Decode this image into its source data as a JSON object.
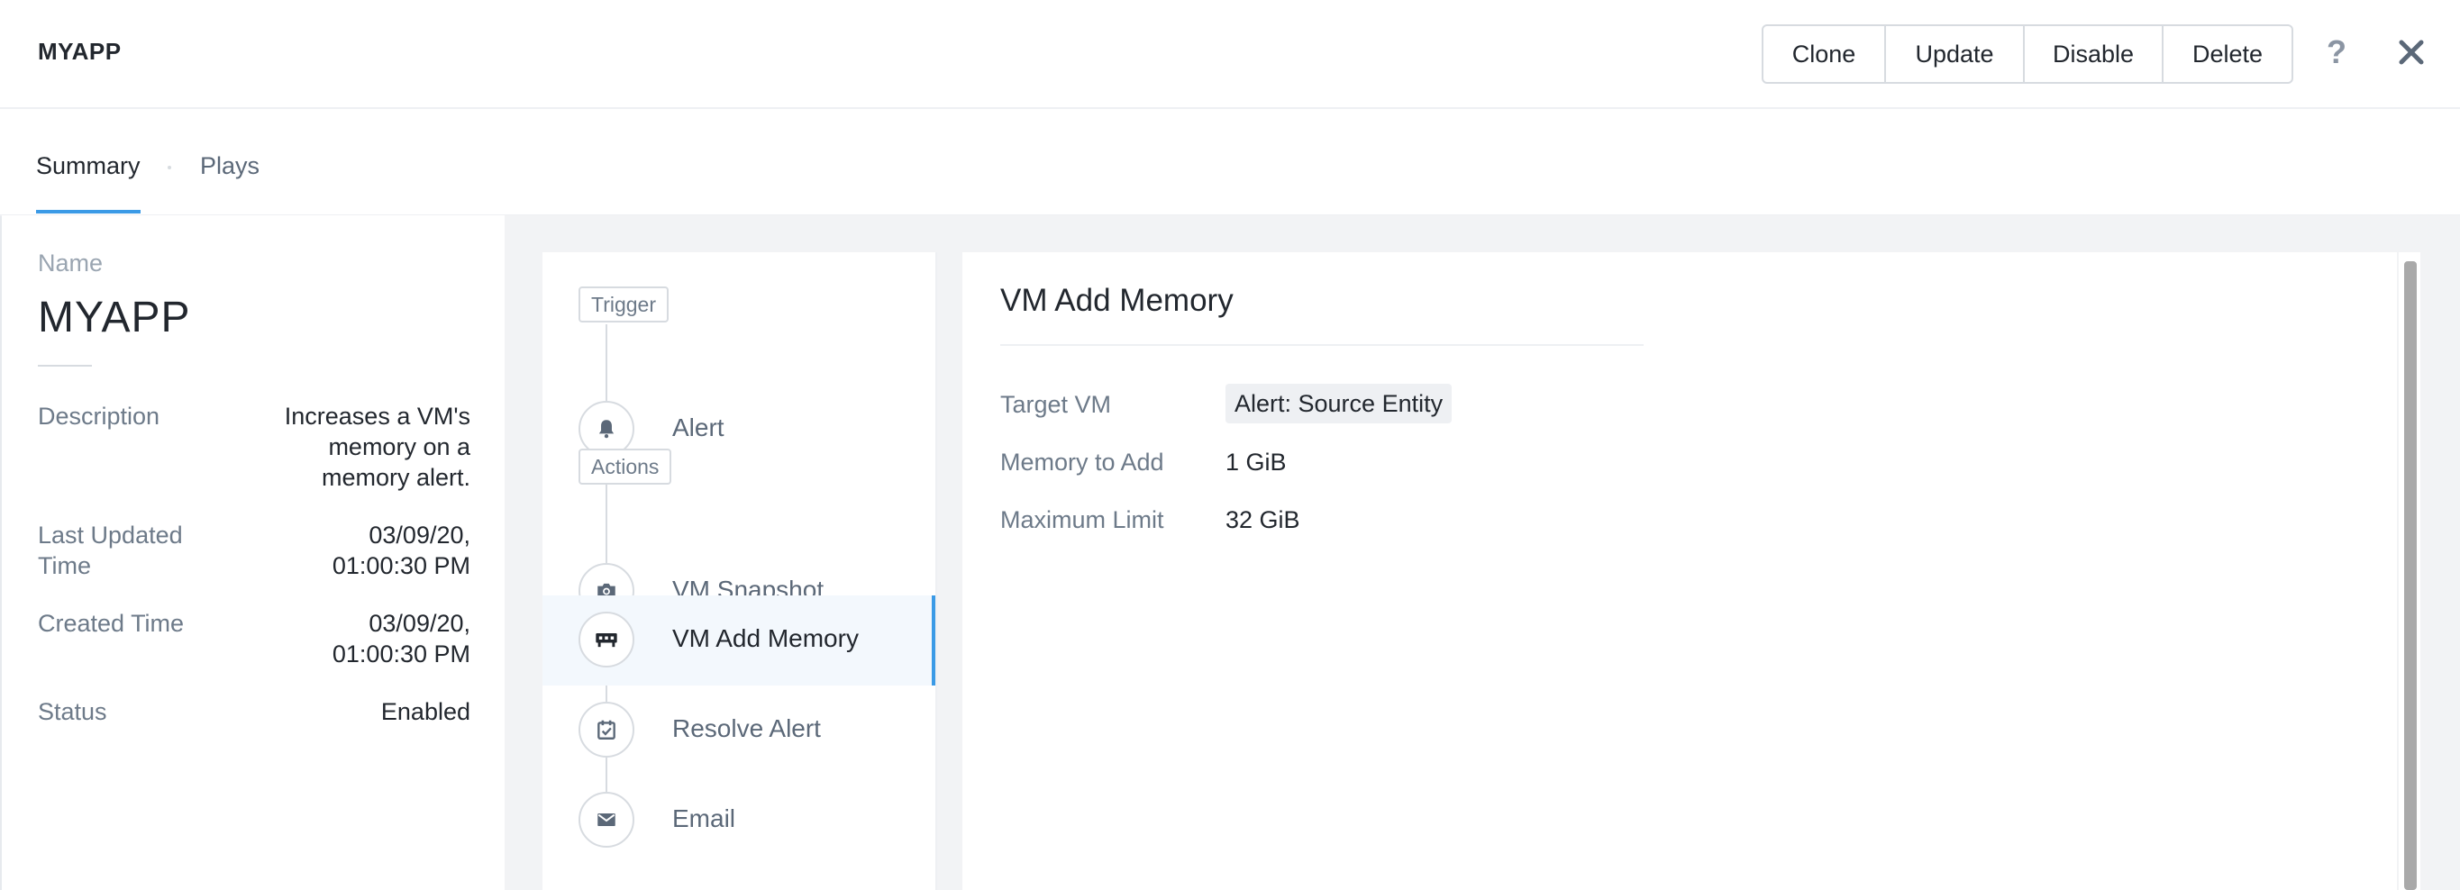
{
  "header": {
    "app_title": "MYAPP",
    "buttons": {
      "clone": "Clone",
      "update": "Update",
      "disable": "Disable",
      "delete": "Delete"
    },
    "help_icon": "question-mark-icon",
    "close_icon": "close-icon",
    "help_glyph": "?"
  },
  "tabs": [
    {
      "label": "Summary",
      "active": true
    },
    {
      "label": "Plays",
      "active": false
    }
  ],
  "summary": {
    "name_label": "Name",
    "name_value": "MYAPP",
    "rows": [
      {
        "label": "Description",
        "value_lines": [
          "Increases a VM's",
          "memory on a",
          "memory alert."
        ]
      },
      {
        "label_lines": [
          "Last Updated",
          "Time"
        ],
        "value_lines": [
          "03/09/20,",
          "01:00:30 PM"
        ]
      },
      {
        "label": "Created Time",
        "value_lines": [
          "03/09/20,",
          "01:00:30 PM"
        ]
      },
      {
        "label": "Status",
        "value": "Enabled"
      }
    ]
  },
  "steps": {
    "trigger_tag": "Trigger",
    "actions_tag": "Actions",
    "items": [
      {
        "label": "Alert",
        "icon": "bell-icon",
        "selected": false
      },
      {
        "label": "VM Snapshot",
        "icon": "camera-icon",
        "selected": false
      },
      {
        "label": "VM Add Memory",
        "icon": "memory-icon",
        "selected": true
      },
      {
        "label": "Resolve Alert",
        "icon": "calendar-check-icon",
        "selected": false
      },
      {
        "label": "Email",
        "icon": "envelope-icon",
        "selected": false
      }
    ]
  },
  "detail": {
    "title": "VM Add Memory",
    "fields": [
      {
        "label": "Target VM",
        "value": "Alert: Source Entity"
      },
      {
        "label": "Memory to Add",
        "value": "1 GiB"
      },
      {
        "label": "Maximum Limit",
        "value": "32 GiB"
      }
    ]
  },
  "colors": {
    "accent": "#3b9ae6",
    "text": "#22272e",
    "muted": "#6d7a89",
    "border": "#d7dbe0",
    "canvas": "#f2f3f5"
  }
}
